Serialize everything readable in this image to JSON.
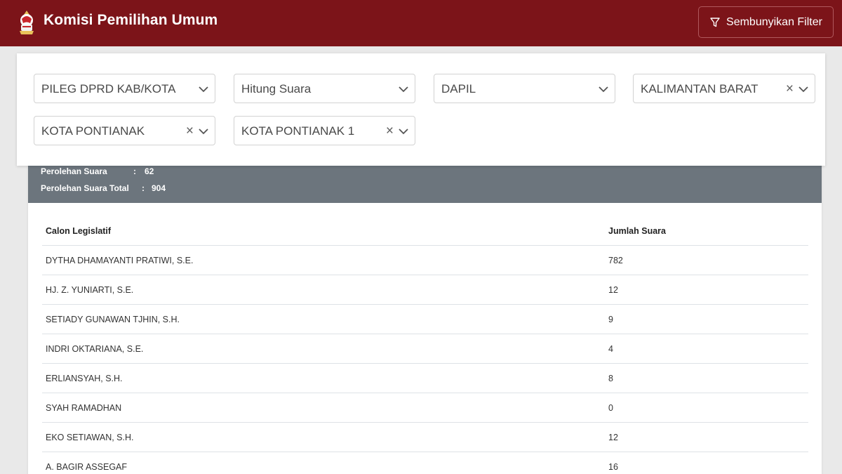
{
  "header": {
    "title": "Komisi Pemilihan Umum",
    "filter_toggle_label": "Sembunyikan Filter"
  },
  "filters": {
    "election_type": "PILEG DPRD KAB/KOTA",
    "data_type": "Hitung Suara",
    "region_level": "DAPIL",
    "province": "KALIMANTAN BARAT",
    "city": "KOTA PONTIANAK",
    "district": "KOTA PONTIANAK 1"
  },
  "summary": {
    "party_votes_label": "Perolehan Suara",
    "party_votes_value": "62",
    "total_votes_label": "Perolehan Suara Total",
    "total_votes_value": "904",
    "separator": ":"
  },
  "table": {
    "headers": {
      "candidate": "Calon Legislatif",
      "votes": "Jumlah Suara"
    },
    "rows": [
      {
        "name": "DYTHA DHAMAYANTI PRATIWI, S.E.",
        "votes": "782"
      },
      {
        "name": "HJ. Z. YUNIARTI, S.E.",
        "votes": "12"
      },
      {
        "name": "SETIADY GUNAWAN TJHIN, S.H.",
        "votes": "9"
      },
      {
        "name": "INDRI OKTARIANA, S.E.",
        "votes": "4"
      },
      {
        "name": "ERLIANSYAH, S.H.",
        "votes": "8"
      },
      {
        "name": "SYAH RAMADHAN",
        "votes": "0"
      },
      {
        "name": "EKO SETIAWAN, S.H.",
        "votes": "12"
      },
      {
        "name": "A. BAGIR ASSEGAF",
        "votes": "16"
      }
    ]
  },
  "icons": {
    "logo": "kpu-logo-icon",
    "filter": "funnel-icon",
    "chevron": "chevron-down-icon",
    "clear": "clear-x-icon"
  },
  "colors": {
    "header_bg": "#7c1419",
    "summary_bg": "#6c757d",
    "page_bg": "#e9e9e9"
  }
}
